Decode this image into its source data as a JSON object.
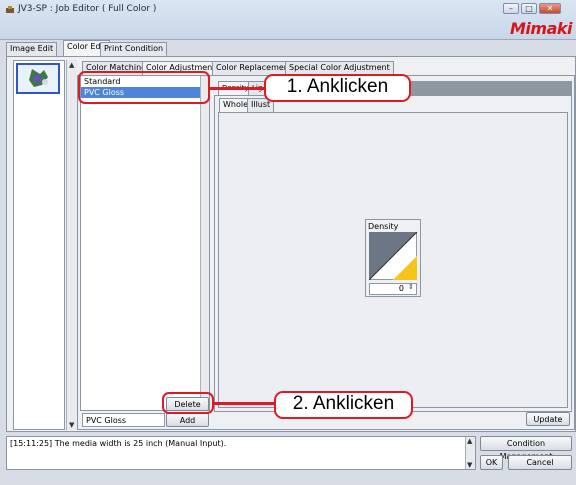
{
  "window": {
    "title": "JV3-SP : Job Editor ( Full Color )",
    "brand": "Mimaki",
    "controls": [
      "–",
      "□",
      "✕"
    ]
  },
  "main_tabs": [
    "Image Edit",
    "Color Edit",
    "Print Condition"
  ],
  "sub_tabs": [
    "Color Matching",
    "Color Adjustment",
    "Color Replacement",
    "Special Color Adjustment"
  ],
  "adjust_list": {
    "items": [
      "Standard",
      "PVC Gloss"
    ],
    "selected": "PVC Gloss",
    "delete_label": "Delete",
    "add_label": "Add",
    "name_value": "PVC Gloss"
  },
  "inner_tabs": [
    "Density",
    "Lig"
  ],
  "curve_tabs": [
    "Whole",
    "Illust"
  ],
  "density": {
    "label": "Density",
    "value": "0"
  },
  "update_label": "Update",
  "log_text": "[15:11:25] The media width is 25 inch (Manual Input).",
  "buttons": {
    "condition_management": "Condition Management",
    "ok": "OK",
    "cancel": "Cancel"
  },
  "callouts": {
    "step1": "1. Anklicken",
    "step2": "2. Anklicken"
  },
  "colors": {
    "highlight": "#e01a22",
    "selection": "#4f85d9",
    "density_dark": "#6d7684",
    "density_light": "#f6c51b"
  }
}
